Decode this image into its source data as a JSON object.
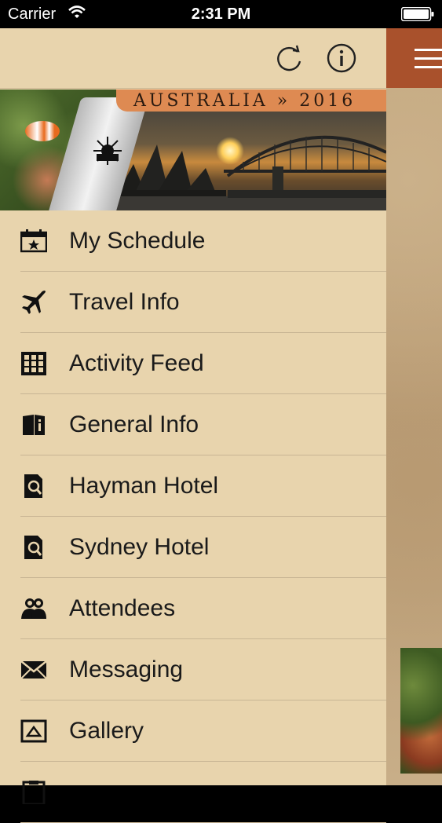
{
  "status_bar": {
    "carrier": "Carrier",
    "time": "2:31 PM"
  },
  "banner": {
    "title": "AUSTRALIA » 2016"
  },
  "header": {
    "refresh_icon": "refresh-icon",
    "info_icon": "info-icon"
  },
  "menu": {
    "items": [
      {
        "label": "My Schedule",
        "icon": "calendar-star-icon"
      },
      {
        "label": "Travel Info",
        "icon": "airplane-icon"
      },
      {
        "label": "Activity Feed",
        "icon": "grid-icon"
      },
      {
        "label": "General Info",
        "icon": "book-info-icon"
      },
      {
        "label": "Hayman Hotel",
        "icon": "hotel-search-icon"
      },
      {
        "label": "Sydney Hotel",
        "icon": "hotel-search-icon"
      },
      {
        "label": "Attendees",
        "icon": "people-icon"
      },
      {
        "label": "Messaging",
        "icon": "envelope-icon"
      },
      {
        "label": "Gallery",
        "icon": "picture-icon"
      }
    ]
  },
  "colors": {
    "drawer_bg": "#e8d4ad",
    "header_accent": "#a9512c",
    "divider": "#c8b594"
  }
}
